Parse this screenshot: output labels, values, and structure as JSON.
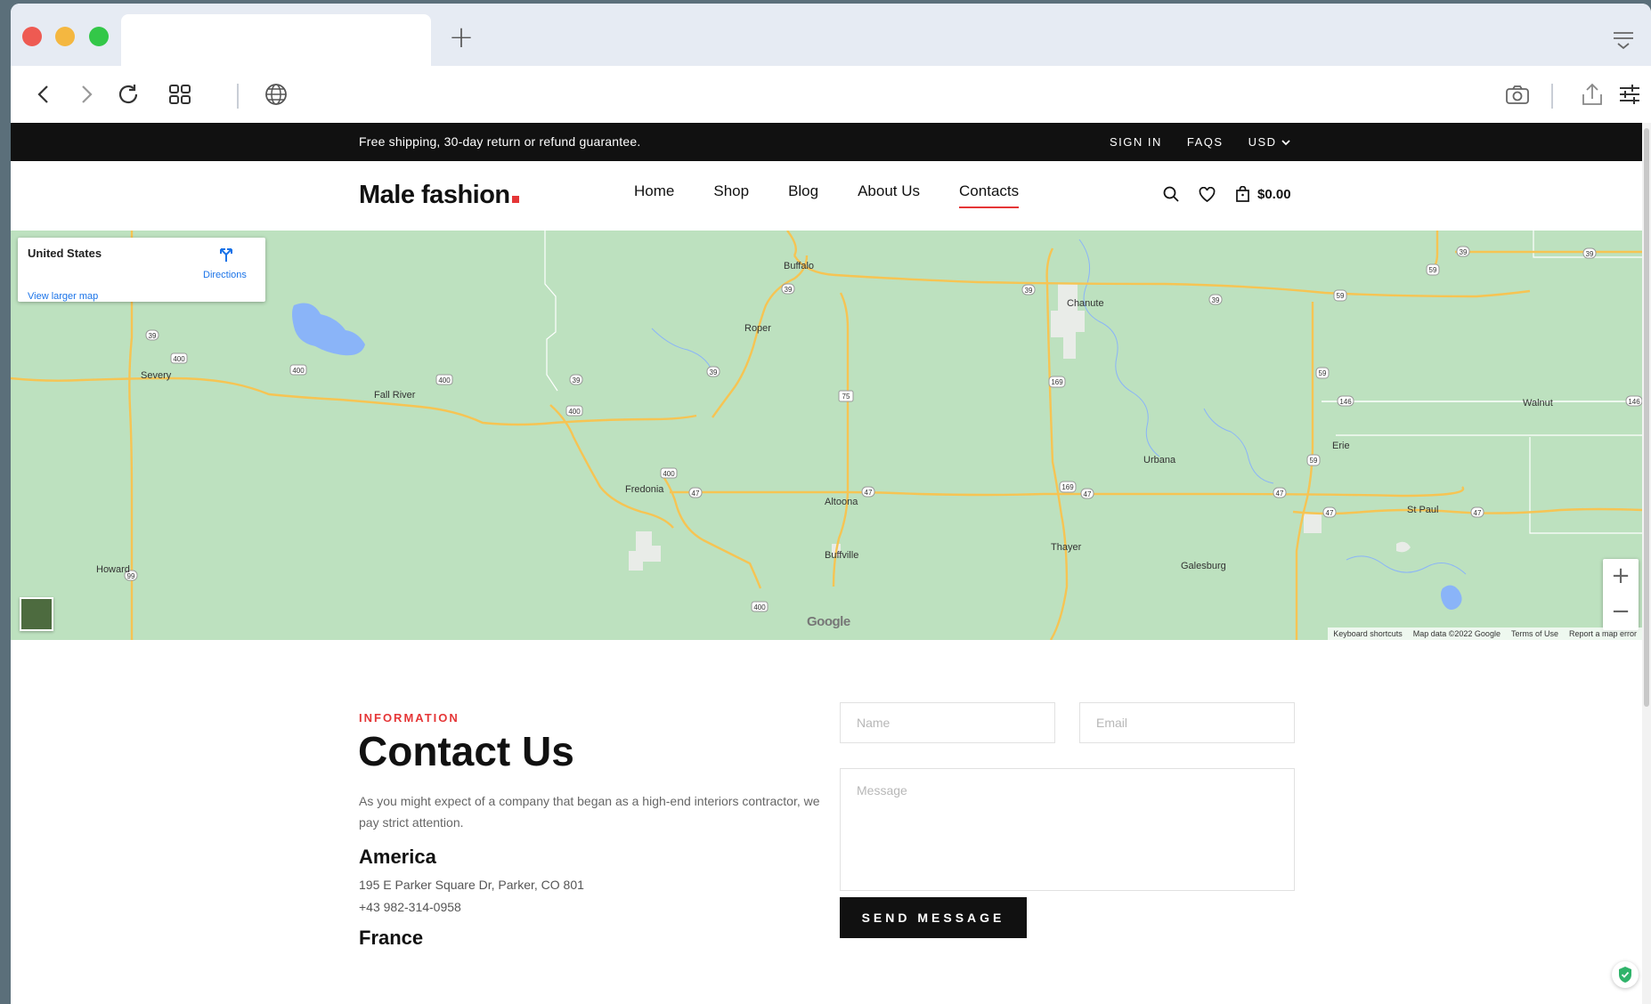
{
  "browser": {
    "new_tab_glyph": "+",
    "toolbar_icons": [
      "back-icon",
      "forward-icon",
      "reload-icon",
      "tab-grid-icon",
      "globe-icon",
      "camera-icon",
      "share-icon",
      "settings-sliders-icon"
    ]
  },
  "topbar": {
    "shipping_text": "Free shipping, 30-day return or refund guarantee.",
    "sign_in": "SIGN IN",
    "faqs": "FAQS",
    "currency": "USD"
  },
  "header": {
    "logo": "Male fashion",
    "nav": [
      "Home",
      "Shop",
      "Blog",
      "About Us",
      "Contacts"
    ],
    "active_nav": "Contacts",
    "cart_total": "$0.00"
  },
  "map": {
    "card_place": "United States",
    "card_directions": "Directions",
    "card_larger": "View larger map",
    "zoom_in": "+",
    "zoom_out": "−",
    "google_mark": "Google",
    "footer": {
      "shortcuts": "Keyboard shortcuts",
      "data": "Map data ©2022 Google",
      "terms": "Terms of Use",
      "report": "Report a map error"
    },
    "towns": [
      "Buffalo",
      "Chanute",
      "Roper",
      "Severy",
      "Fall River",
      "Walnut",
      "Erie",
      "Urbana",
      "Fredonia",
      "Altoona",
      "St Paul",
      "Thayer",
      "Buffville",
      "Galesburg",
      "Howard"
    ],
    "route_shields": [
      "39",
      "99",
      "400",
      "75",
      "169",
      "59",
      "146",
      "47"
    ]
  },
  "contact": {
    "label": "INFORMATION",
    "title": "Contact Us",
    "intro": "As you might expect of a company that began as a high-end interiors contractor, we pay strict attention.",
    "regions": [
      {
        "name": "America",
        "address": "195 E Parker Square Dr, Parker, CO 801",
        "phone": "+43 982-314-0958"
      },
      {
        "name": "France"
      }
    ],
    "form": {
      "name_placeholder": "Name",
      "email_placeholder": "Email",
      "message_placeholder": "Message",
      "send_label": "SEND MESSAGE"
    }
  },
  "colors": {
    "accent": "#e53637",
    "topbar_bg": "#111111",
    "map_land": "#bde1bf",
    "map_road": "#f6c453"
  }
}
